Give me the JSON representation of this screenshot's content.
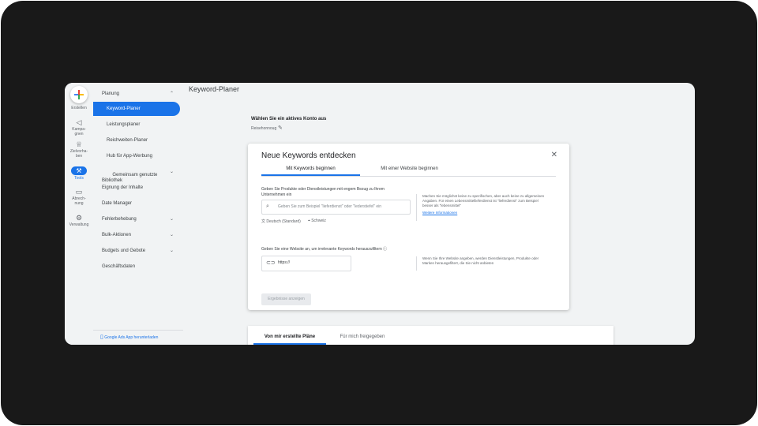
{
  "page": {
    "title": "Keyword-Planer"
  },
  "rail": {
    "create_label": "Erstellen",
    "items": [
      {
        "icon": "campaign-icon",
        "glyph": "📢",
        "label": "Kampa-\ngnen"
      },
      {
        "icon": "goal-icon",
        "glyph": "🏆",
        "label": "Zielvorha-\nben"
      },
      {
        "icon": "tools-icon",
        "glyph": "⚒",
        "label": "Tools"
      },
      {
        "icon": "billing-icon",
        "glyph": "▭",
        "label": "Abrech-\nnung"
      },
      {
        "icon": "admin-icon",
        "glyph": "⚙",
        "label": "Verwaltung"
      }
    ]
  },
  "nav": {
    "items": [
      {
        "label": "Planung",
        "chevron": "^"
      },
      {
        "label": "Keyword-Planer",
        "active": true
      },
      {
        "label": "Leistungsplaner"
      },
      {
        "label": "Reichweiten-Planer"
      },
      {
        "label": "Hub für App-Werbung"
      },
      {
        "label": "Gemeinsam genutzte\nBibliothek",
        "chevron": "v"
      },
      {
        "label": "Eignung der Inhalte"
      },
      {
        "label": "Date Manager"
      },
      {
        "label": "Fehlerbehebung",
        "chevron": "v"
      },
      {
        "label": "Bulk-Aktionen",
        "chevron": "v"
      },
      {
        "label": "Budgets und Gebote",
        "chevron": "v"
      },
      {
        "label": "Geschäftsdaten"
      }
    ],
    "app_link": "Google Ads App herunterladen"
  },
  "account": {
    "title": "Wählen Sie ein aktives Konto aus",
    "name": "Reisehonnoug"
  },
  "card": {
    "title": "Neue Keywords entdecken",
    "tabs": [
      "Mit Keywords beginnen",
      "Mit einer Website beginnen"
    ],
    "keywords_label": "Geben Sie Produkte oder Dienstleistungen mit engem Bezug zu Ihrem Unternehmen ein",
    "keywords_placeholder": "Geben Sie zum Beispiel \"lieferdienst\" oder \"lederstiefel\" ein",
    "language": "Deutsch (Standard)",
    "location": "Schweiz",
    "keywords_help": "Machen Sie möglichst keine zu spezifischen, aber auch keine zu allgemeinen Angaben. Für einen Lebensmittellieferdienst ist \"lieferdienst\" zum Beispiel besser als \"lebensmittel\"",
    "help_link": "Weitere Informationen",
    "website_label": "Geben Sie eine Website an, um irrelevante Keywords herauszufiltern",
    "website_placeholder": "https://",
    "website_help": "Wenn Sie Ihre Website angeben, werden Dienstleistungen, Produkte oder Marken herausgefiltert, die Sie nicht anbieten",
    "results_button": "Ergebnisse anzeigen"
  },
  "plans": {
    "tabs": [
      "Von mir erstellte Pläne",
      "Für mich freigegeben"
    ]
  }
}
